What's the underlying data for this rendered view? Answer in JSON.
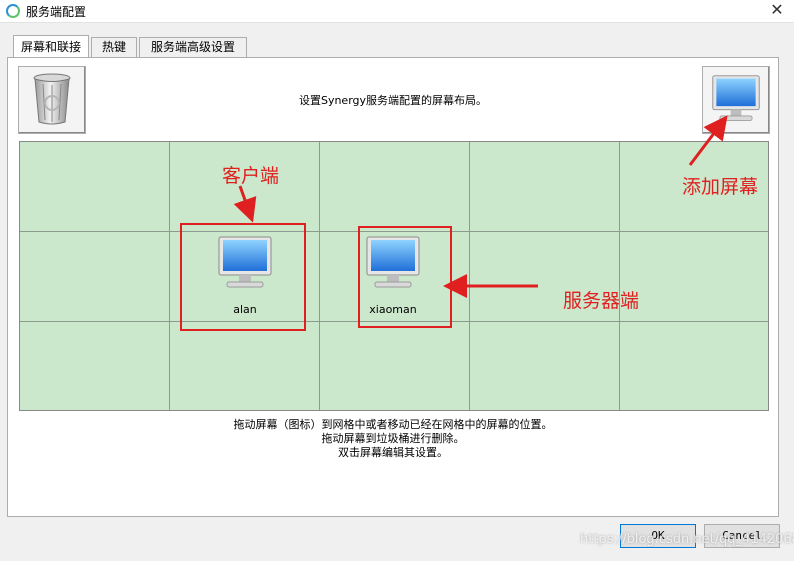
{
  "window": {
    "title": "服务端配置"
  },
  "tabs": [
    {
      "label": "屏幕和联接",
      "active": true
    },
    {
      "label": "热键",
      "active": false
    },
    {
      "label": "服务端高级设置",
      "active": false
    }
  ],
  "layout_tab": {
    "description": "设置Synergy服务端配置的屏幕布局。",
    "screens": [
      {
        "name": "alan",
        "icon": "monitor-icon"
      },
      {
        "name": "xiaoman",
        "icon": "monitor-icon"
      }
    ],
    "hints": [
      "拖动屏幕（图标）到网格中或者移动已经在网格中的屏幕的位置。",
      "拖动屏幕到垃圾桶进行删除。",
      "双击屏幕编辑其设置。"
    ]
  },
  "annotations": {
    "client_label": "客户端",
    "add_screen_label": "添加屏幕",
    "server_label": "服务器端"
  },
  "footer": {
    "ok_label": "OK",
    "cancel_label": "Cancel"
  },
  "watermark": "https://blog.csdn.net/qq_41420688",
  "colors": {
    "grid_bg": "#cce8cc",
    "annotation": "#e02020",
    "monitor_blue": "#3a8ee6"
  },
  "icons": {
    "close": "close-icon",
    "trash": "trash-icon",
    "add_screen": "monitor-icon"
  }
}
